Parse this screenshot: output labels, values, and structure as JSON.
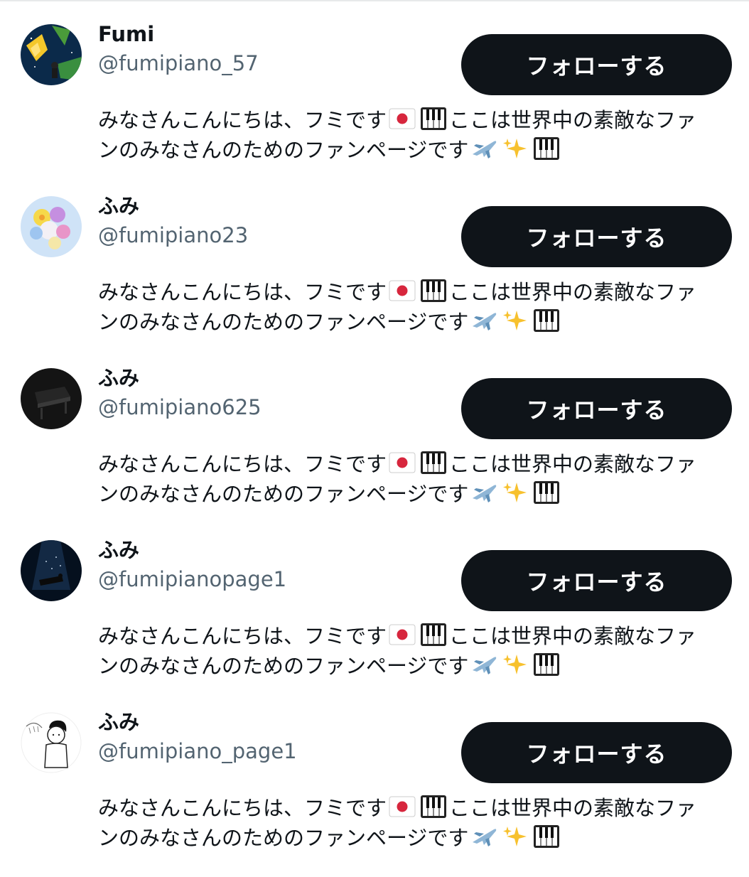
{
  "follow_label": "フォローする",
  "users": [
    {
      "name": "Fumi",
      "handle": "@fumipiano_57",
      "bio_line1": "みなさんこんにちは、フミです",
      "bio_line1b": "ここは世界中の素敵なファ",
      "bio_line2": "ンのみなさんのためのファンページです",
      "avatar": "yellow-flower-on-night-sky"
    },
    {
      "name": "ふみ",
      "handle": "@fumipiano23",
      "bio_line1": "みなさんこんにちは、フミです",
      "bio_line1b": "ここは世界中の素敵なファ",
      "bio_line2": "ンのみなさんのためのファンページです",
      "avatar": "flower-bouquet"
    },
    {
      "name": "ふみ",
      "handle": "@fumipiano625",
      "bio_line1": "みなさんこんにちは、フミです",
      "bio_line1b": "ここは世界中の素敵なファ",
      "bio_line2": "ンのみなさんのためのファンページです",
      "avatar": "dark-grand-piano"
    },
    {
      "name": "ふみ",
      "handle": "@fumipianopage1",
      "bio_line1": "みなさんこんにちは、フミです",
      "bio_line1b": "ここは世界中の素敵なファ",
      "bio_line2": "ンのみなさんのためのファンページです",
      "avatar": "pianist-under-spotlight"
    },
    {
      "name": "ふみ",
      "handle": "@fumipiano_page1",
      "bio_line1": "みなさんこんにちは、フミです",
      "bio_line1b": "ここは世界中の素敵なファ",
      "bio_line2": "ンのみなさんのためのファンページです",
      "avatar": "cartoon-boy-sketch"
    }
  ],
  "bio_emojis": [
    "japan-flag-icon",
    "piano-keys-icon",
    "airplane-icon",
    "sparkles-icon",
    "piano-keys-icon"
  ],
  "colors": {
    "button_bg": "#0f1419",
    "button_text": "#ffffff",
    "handle": "#536471",
    "text": "#0f1419"
  }
}
